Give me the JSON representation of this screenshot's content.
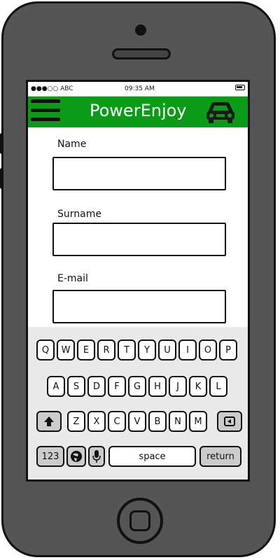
{
  "status_bar": {
    "carrier": "●●●○○ ABC",
    "time": "09:35 AM"
  },
  "app_bar": {
    "title": "PowerEnjoy",
    "menu_icon": "hamburger-menu-icon",
    "logo_icon": "car-icon"
  },
  "form": {
    "fields": [
      {
        "label": "Name",
        "value": ""
      },
      {
        "label": "Surname",
        "value": ""
      },
      {
        "label": "E-mail",
        "value": ""
      }
    ]
  },
  "keyboard": {
    "row1": [
      "Q",
      "W",
      "E",
      "R",
      "T",
      "Y",
      "U",
      "I",
      "O",
      "P"
    ],
    "row2": [
      "A",
      "S",
      "D",
      "F",
      "G",
      "H",
      "J",
      "K",
      "L"
    ],
    "row3": [
      "Z",
      "X",
      "C",
      "V",
      "B",
      "N",
      "M"
    ],
    "numbers_key": "123",
    "space_key": "space",
    "return_key": "return",
    "shift_icon": "shift-arrow-icon",
    "backspace_icon": "backspace-icon",
    "globe_icon": "globe-icon",
    "mic_icon": "microphone-icon"
  },
  "colors": {
    "appbar": "#0b9c17",
    "phone_body": "#555555",
    "keyboard_bg": "#e9e9e9"
  }
}
